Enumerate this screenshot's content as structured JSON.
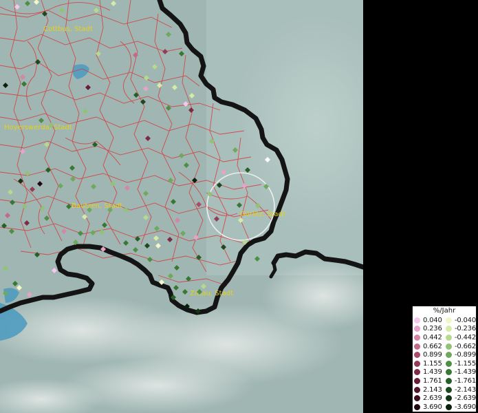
{
  "map": {
    "labels": [
      {
        "key": "cottbus",
        "text": "Cottbus, Stadt"
      },
      {
        "key": "hoyerswerda",
        "text": "Hoyerswerda, Stadt"
      },
      {
        "key": "bautzen",
        "text": "Bautzen, Stadt"
      },
      {
        "key": "goerlitz",
        "text": "Görlitz, Stadt"
      },
      {
        "key": "zittau",
        "text": "Zittau, Stadt"
      }
    ],
    "colors": {
      "terrain": "#a4b8b4",
      "district_lines": "#d8383a",
      "border": "#141414",
      "label": "#e6d21a",
      "highlight_ring": "#f4f4f4"
    }
  },
  "legend": {
    "title": "%/Jahr",
    "positive": [
      {
        "value": "0.040",
        "color": "#f6c6ec"
      },
      {
        "value": "0.236",
        "color": "#e6a3c7"
      },
      {
        "value": "0.442",
        "color": "#d684a8"
      },
      {
        "value": "0.662",
        "color": "#c3698b"
      },
      {
        "value": "0.899",
        "color": "#a94b6a"
      },
      {
        "value": "1.155",
        "color": "#933c57"
      },
      {
        "value": "1.439",
        "color": "#7c2a45"
      },
      {
        "value": "1.761",
        "color": "#691c36"
      },
      {
        "value": "2.143",
        "color": "#53152a"
      },
      {
        "value": "2.639",
        "color": "#3c0e1d"
      },
      {
        "value": "3.690",
        "color": "#220610"
      }
    ],
    "negative": [
      {
        "value": "-0.040",
        "color": "#f2f6c8"
      },
      {
        "value": "-0.236",
        "color": "#d7eba8"
      },
      {
        "value": "-0.442",
        "color": "#b6d98d"
      },
      {
        "value": "-0.662",
        "color": "#92c275"
      },
      {
        "value": "-0.899",
        "color": "#6fa95d"
      },
      {
        "value": "-1.155",
        "color": "#4e8f45"
      },
      {
        "value": "-1.439",
        "color": "#387835"
      },
      {
        "value": "-1.761",
        "color": "#275f28"
      },
      {
        "value": "-2.143",
        "color": "#1c4a1e"
      },
      {
        "value": "-2.639",
        "color": "#123515"
      },
      {
        "value": "-3.690",
        "color": "#0a200c"
      }
    ]
  }
}
